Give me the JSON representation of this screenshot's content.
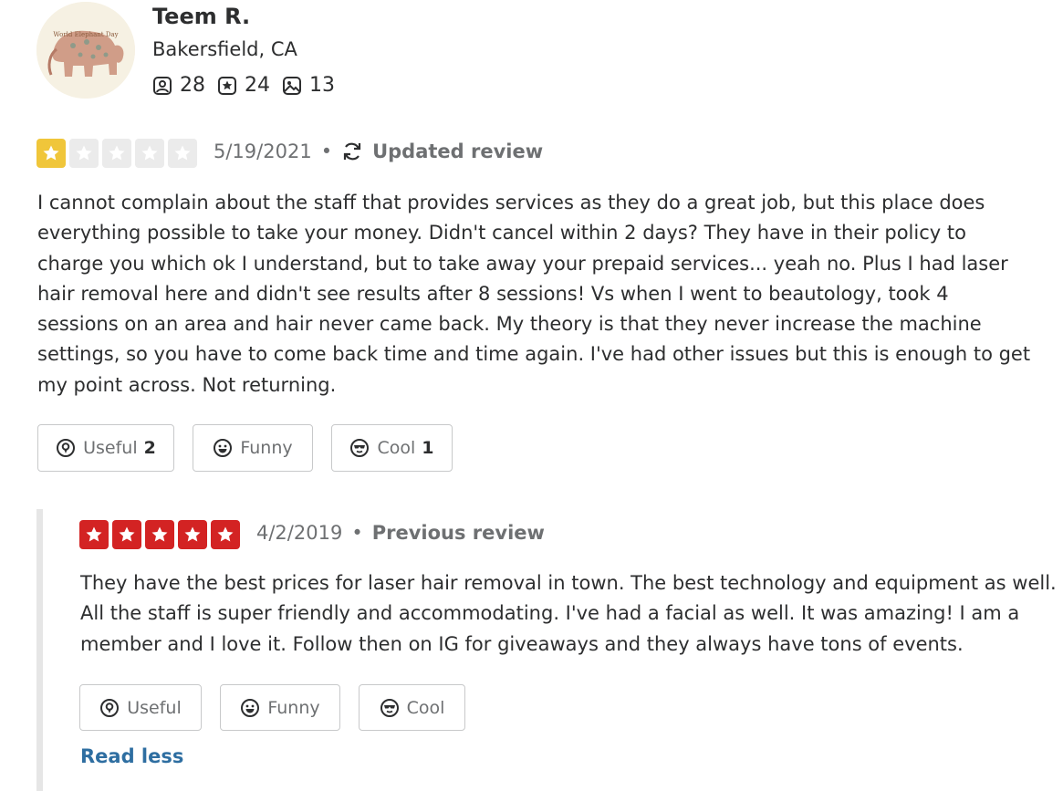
{
  "user": {
    "name": "Teem R.",
    "location": "Bakersfield, CA",
    "avatar_text": "World Elephant Day",
    "friends_count": "28",
    "reviews_count": "24",
    "photos_count": "13"
  },
  "current_review": {
    "rating": 1,
    "max_rating": 5,
    "star_color": "#f0c63a",
    "date": "5/19/2021",
    "kind_label": "Updated review",
    "text": "I cannot complain about the staff that provides services as they do a great job, but this place does everything possible to take your money. Didn't cancel within 2 days? They have in their policy to charge you which ok I understand, but to take away your prepaid services... yeah no. Plus I had laser hair removal here and didn't see results after 8 sessions! Vs when I went to beautology, took 4 sessions on an area and hair never came back. My theory is that they never increase the machine settings, so you have to come back time and time again. I've had other issues but this is enough to get my point across. Not returning.",
    "buttons": {
      "useful_label": "Useful",
      "useful_count": "2",
      "funny_label": "Funny",
      "funny_count": "",
      "cool_label": "Cool",
      "cool_count": "1"
    }
  },
  "previous_review": {
    "rating": 5,
    "max_rating": 5,
    "star_color": "#d32323",
    "date": "4/2/2019",
    "kind_label": "Previous review",
    "text": "They have the best prices for laser hair removal in town. The best technology and equipment as well. All the staff is super friendly and accommodating. I've had a facial as well. It was amazing! I am a member and I love it. Follow then on IG for giveaways and they always have tons of events.",
    "buttons": {
      "useful_label": "Useful",
      "funny_label": "Funny",
      "cool_label": "Cool"
    }
  },
  "read_less_label": "Read less",
  "colors": {
    "empty_star": "#ebebeb",
    "link": "#2e6ea1",
    "text": "#2d2e2f",
    "muted": "#6e7072"
  }
}
